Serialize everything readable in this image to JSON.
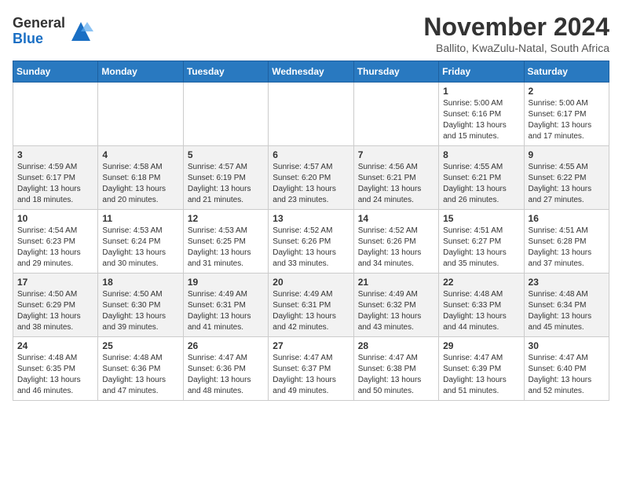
{
  "header": {
    "logo_general": "General",
    "logo_blue": "Blue",
    "month_year": "November 2024",
    "location": "Ballito, KwaZulu-Natal, South Africa"
  },
  "days_of_week": [
    "Sunday",
    "Monday",
    "Tuesday",
    "Wednesday",
    "Thursday",
    "Friday",
    "Saturday"
  ],
  "weeks": [
    [
      {
        "day": "",
        "info": ""
      },
      {
        "day": "",
        "info": ""
      },
      {
        "day": "",
        "info": ""
      },
      {
        "day": "",
        "info": ""
      },
      {
        "day": "",
        "info": ""
      },
      {
        "day": "1",
        "info": "Sunrise: 5:00 AM\nSunset: 6:16 PM\nDaylight: 13 hours\nand 15 minutes."
      },
      {
        "day": "2",
        "info": "Sunrise: 5:00 AM\nSunset: 6:17 PM\nDaylight: 13 hours\nand 17 minutes."
      }
    ],
    [
      {
        "day": "3",
        "info": "Sunrise: 4:59 AM\nSunset: 6:17 PM\nDaylight: 13 hours\nand 18 minutes."
      },
      {
        "day": "4",
        "info": "Sunrise: 4:58 AM\nSunset: 6:18 PM\nDaylight: 13 hours\nand 20 minutes."
      },
      {
        "day": "5",
        "info": "Sunrise: 4:57 AM\nSunset: 6:19 PM\nDaylight: 13 hours\nand 21 minutes."
      },
      {
        "day": "6",
        "info": "Sunrise: 4:57 AM\nSunset: 6:20 PM\nDaylight: 13 hours\nand 23 minutes."
      },
      {
        "day": "7",
        "info": "Sunrise: 4:56 AM\nSunset: 6:21 PM\nDaylight: 13 hours\nand 24 minutes."
      },
      {
        "day": "8",
        "info": "Sunrise: 4:55 AM\nSunset: 6:21 PM\nDaylight: 13 hours\nand 26 minutes."
      },
      {
        "day": "9",
        "info": "Sunrise: 4:55 AM\nSunset: 6:22 PM\nDaylight: 13 hours\nand 27 minutes."
      }
    ],
    [
      {
        "day": "10",
        "info": "Sunrise: 4:54 AM\nSunset: 6:23 PM\nDaylight: 13 hours\nand 29 minutes."
      },
      {
        "day": "11",
        "info": "Sunrise: 4:53 AM\nSunset: 6:24 PM\nDaylight: 13 hours\nand 30 minutes."
      },
      {
        "day": "12",
        "info": "Sunrise: 4:53 AM\nSunset: 6:25 PM\nDaylight: 13 hours\nand 31 minutes."
      },
      {
        "day": "13",
        "info": "Sunrise: 4:52 AM\nSunset: 6:26 PM\nDaylight: 13 hours\nand 33 minutes."
      },
      {
        "day": "14",
        "info": "Sunrise: 4:52 AM\nSunset: 6:26 PM\nDaylight: 13 hours\nand 34 minutes."
      },
      {
        "day": "15",
        "info": "Sunrise: 4:51 AM\nSunset: 6:27 PM\nDaylight: 13 hours\nand 35 minutes."
      },
      {
        "day": "16",
        "info": "Sunrise: 4:51 AM\nSunset: 6:28 PM\nDaylight: 13 hours\nand 37 minutes."
      }
    ],
    [
      {
        "day": "17",
        "info": "Sunrise: 4:50 AM\nSunset: 6:29 PM\nDaylight: 13 hours\nand 38 minutes."
      },
      {
        "day": "18",
        "info": "Sunrise: 4:50 AM\nSunset: 6:30 PM\nDaylight: 13 hours\nand 39 minutes."
      },
      {
        "day": "19",
        "info": "Sunrise: 4:49 AM\nSunset: 6:31 PM\nDaylight: 13 hours\nand 41 minutes."
      },
      {
        "day": "20",
        "info": "Sunrise: 4:49 AM\nSunset: 6:31 PM\nDaylight: 13 hours\nand 42 minutes."
      },
      {
        "day": "21",
        "info": "Sunrise: 4:49 AM\nSunset: 6:32 PM\nDaylight: 13 hours\nand 43 minutes."
      },
      {
        "day": "22",
        "info": "Sunrise: 4:48 AM\nSunset: 6:33 PM\nDaylight: 13 hours\nand 44 minutes."
      },
      {
        "day": "23",
        "info": "Sunrise: 4:48 AM\nSunset: 6:34 PM\nDaylight: 13 hours\nand 45 minutes."
      }
    ],
    [
      {
        "day": "24",
        "info": "Sunrise: 4:48 AM\nSunset: 6:35 PM\nDaylight: 13 hours\nand 46 minutes."
      },
      {
        "day": "25",
        "info": "Sunrise: 4:48 AM\nSunset: 6:36 PM\nDaylight: 13 hours\nand 47 minutes."
      },
      {
        "day": "26",
        "info": "Sunrise: 4:47 AM\nSunset: 6:36 PM\nDaylight: 13 hours\nand 48 minutes."
      },
      {
        "day": "27",
        "info": "Sunrise: 4:47 AM\nSunset: 6:37 PM\nDaylight: 13 hours\nand 49 minutes."
      },
      {
        "day": "28",
        "info": "Sunrise: 4:47 AM\nSunset: 6:38 PM\nDaylight: 13 hours\nand 50 minutes."
      },
      {
        "day": "29",
        "info": "Sunrise: 4:47 AM\nSunset: 6:39 PM\nDaylight: 13 hours\nand 51 minutes."
      },
      {
        "day": "30",
        "info": "Sunrise: 4:47 AM\nSunset: 6:40 PM\nDaylight: 13 hours\nand 52 minutes."
      }
    ]
  ]
}
